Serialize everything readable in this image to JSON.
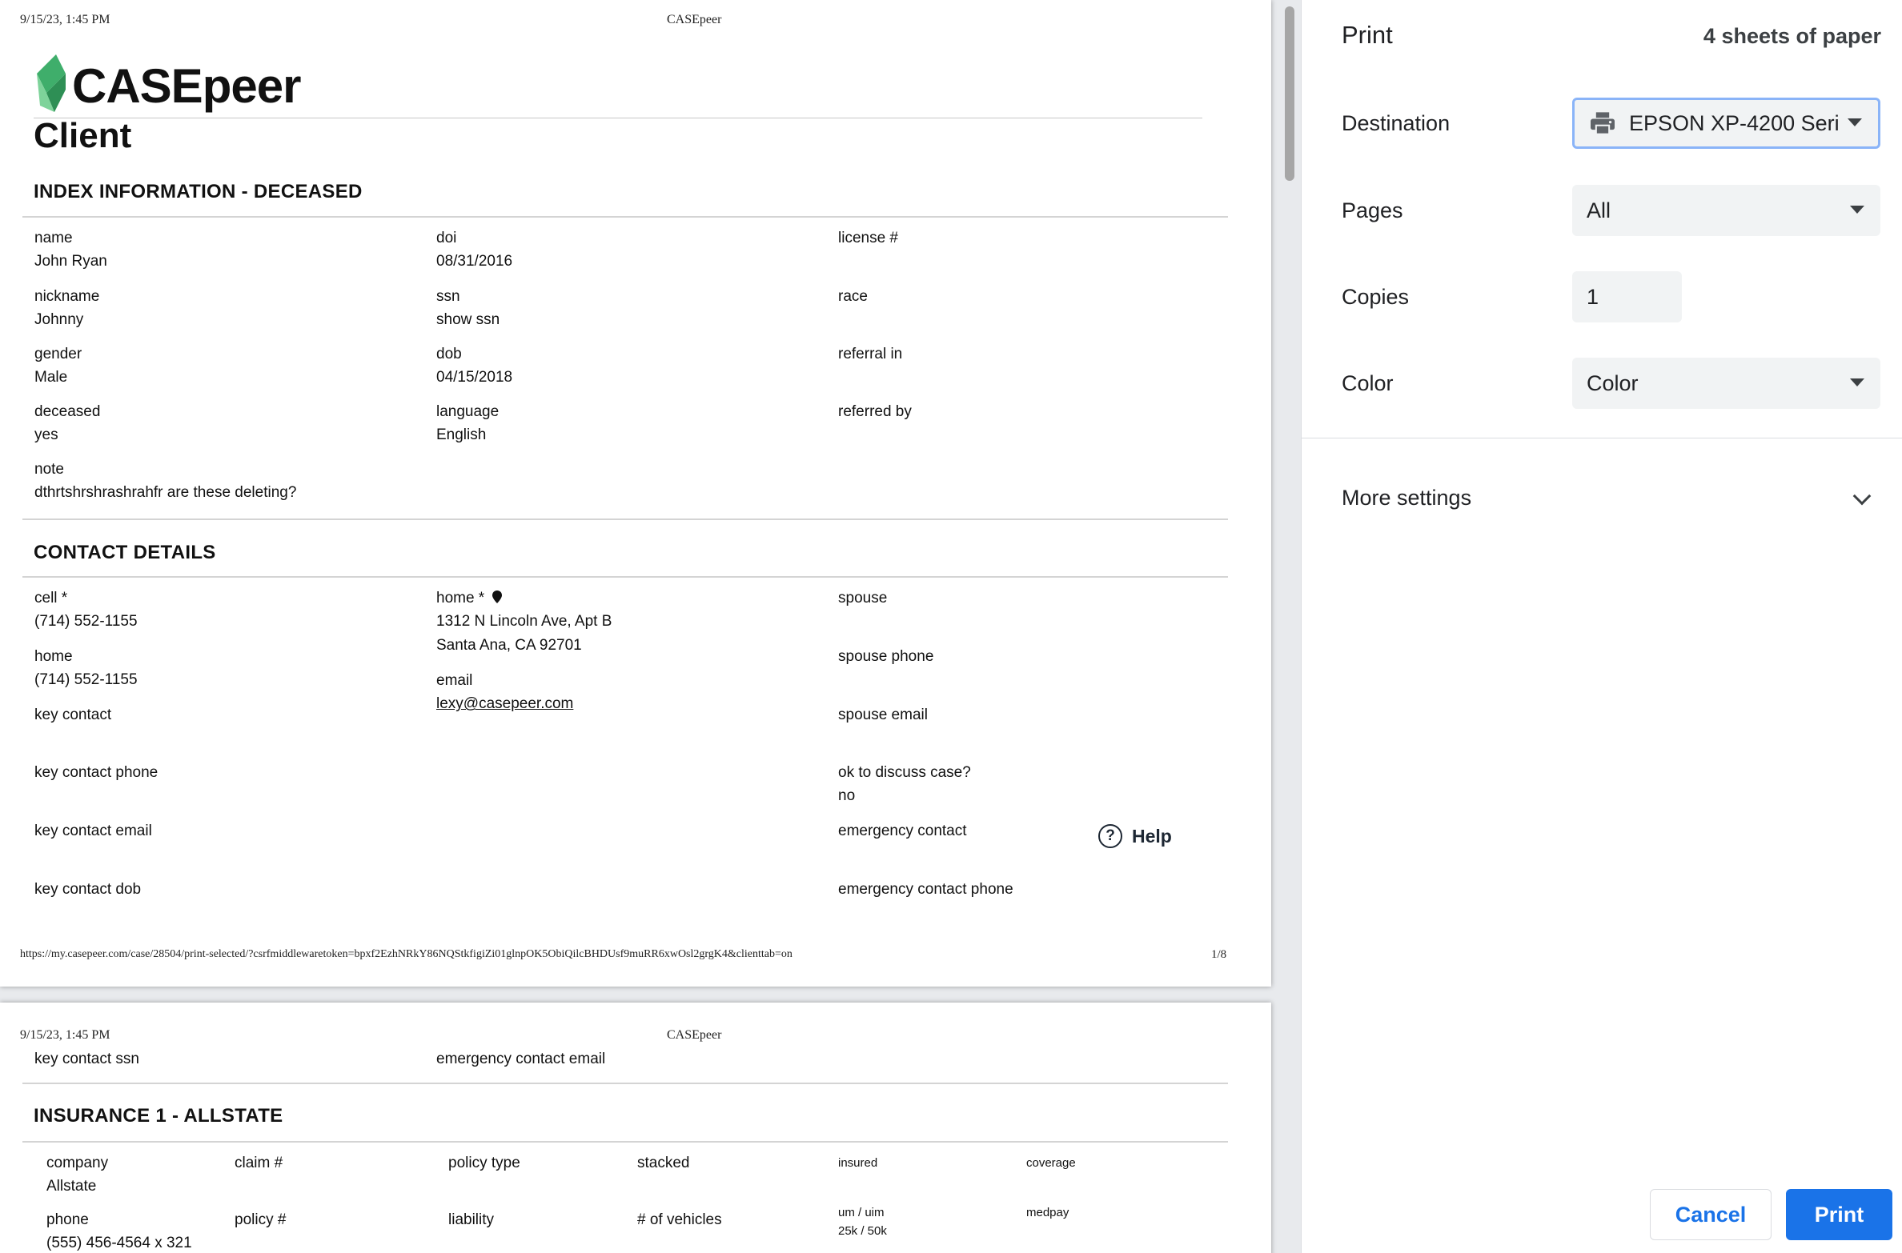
{
  "page_header": {
    "date": "9/15/23, 1:45 PM",
    "title": "CASEpeer"
  },
  "page_footer": {
    "url": "https://my.casepeer.com/case/28504/print-selected/?csrfmiddlewaretoken=bpxf2EzhNRkY86NQStkfigiZi01glnpOK5ObiQilcBHDUsf9muRR6xwOsl2grgK4&clienttab=on",
    "page_num": "1/8"
  },
  "logo_text": "CASEpeer",
  "client_title": "Client",
  "index_section": {
    "title": "INDEX INFORMATION - DECEASED",
    "name_label": "name",
    "name_value": "John Ryan",
    "doi_label": "doi",
    "doi_value": "08/31/2016",
    "license_label": "license #",
    "nickname_label": "nickname",
    "nickname_value": "Johnny",
    "ssn_label": "ssn",
    "ssn_value": "show ssn",
    "race_label": "race",
    "gender_label": "gender",
    "gender_value": "Male",
    "dob_label": "dob",
    "dob_value": "04/15/2018",
    "referral_in_label": "referral in",
    "deceased_label": "deceased",
    "deceased_value": "yes",
    "language_label": "language",
    "language_value": "English",
    "referred_by_label": "referred by",
    "note_label": "note",
    "note_value": "dthrtshrshrashrahfr are these deleting?"
  },
  "contact_section": {
    "title": "CONTACT DETAILS",
    "cell_label": "cell *",
    "cell_value": "(714) 552-1155",
    "home_addr_label": "home *",
    "home_addr_line1": "1312 N Lincoln Ave, Apt B",
    "home_addr_line2": "Santa Ana, CA 92701",
    "spouse_label": "spouse",
    "home_label": "home",
    "home_value": "(714) 552-1155",
    "email_label": "email",
    "email_value": "lexy@casepeer.com",
    "spouse_phone_label": "spouse phone",
    "key_contact_label": "key contact",
    "spouse_email_label": "spouse email",
    "key_contact_phone_label": "key contact phone",
    "ok_discuss_label": "ok to discuss case?",
    "ok_discuss_value": "no",
    "key_contact_email_label": "key contact email",
    "emergency_contact_label": "emergency contact",
    "key_contact_dob_label": "key contact dob",
    "emergency_contact_phone_label": "emergency contact phone",
    "key_contact_ssn_label": "key contact ssn",
    "emergency_contact_email_label": "emergency contact email"
  },
  "help_label": "Help",
  "insurance_section": {
    "title": "INSURANCE 1 - ALLSTATE",
    "company_label": "company",
    "company_value": "Allstate",
    "claim_label": "claim #",
    "policy_type_label": "policy type",
    "stacked_label": "stacked",
    "insured_label": "insured",
    "coverage_label": "coverage",
    "phone_label": "phone",
    "phone_value": "(555) 456-4564 x 321",
    "policy_label": "policy #",
    "liability_label": "liability",
    "vehicles_label": "# of vehicles",
    "um_label": "um / uim",
    "um_value": "25k / 50k",
    "medpay_label": "medpay"
  },
  "print_panel": {
    "title": "Print",
    "sheets": "4 sheets of paper",
    "destination_label": "Destination",
    "destination_value": "EPSON XP-4200 Seri",
    "pages_label": "Pages",
    "pages_value": "All",
    "copies_label": "Copies",
    "copies_value": "1",
    "color_label": "Color",
    "color_value": "Color",
    "more_settings": "More settings",
    "cancel": "Cancel",
    "print": "Print"
  },
  "colors": {
    "accent": "#1a73e8",
    "logo_green": "#3fae6b",
    "focus_ring": "#8ab4f8"
  }
}
